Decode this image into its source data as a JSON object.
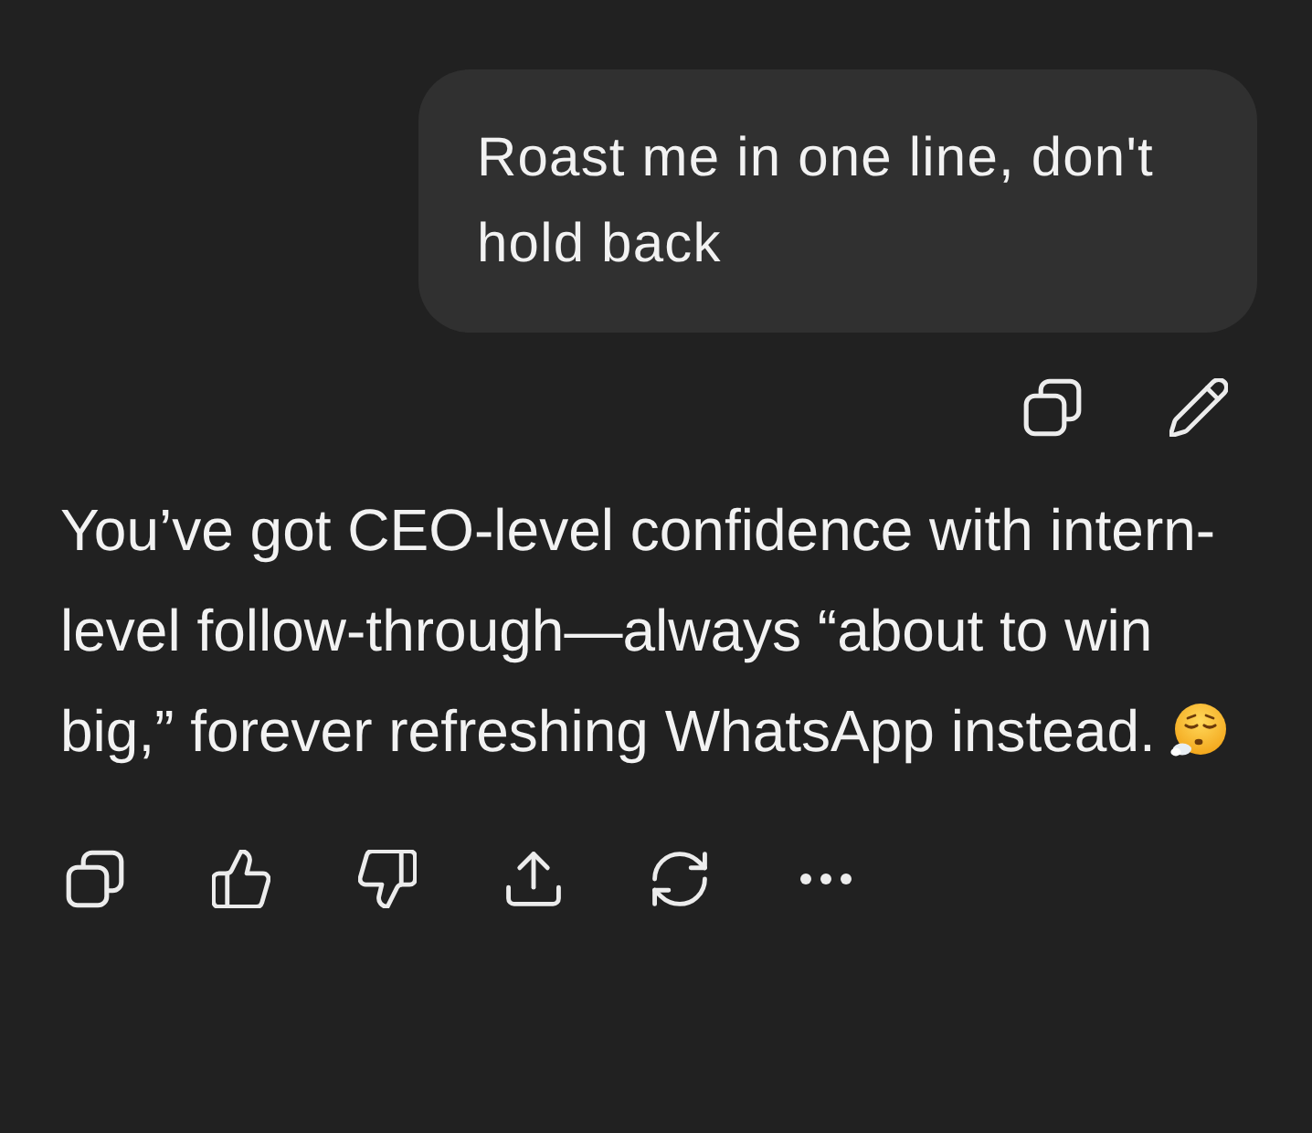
{
  "user_message": {
    "text": "Roast me in one line, don't hold back",
    "actions": [
      {
        "kind": "copy"
      },
      {
        "kind": "edit"
      }
    ]
  },
  "assistant_message": {
    "text": "You’ve got CEO-level confidence with intern-level follow-through—always “about to win big,” forever refreshing WhatsApp instead.",
    "actions": [
      {
        "kind": "copy"
      },
      {
        "kind": "like"
      },
      {
        "kind": "dislike"
      },
      {
        "kind": "share"
      },
      {
        "kind": "regenerate"
      },
      {
        "kind": "more"
      }
    ]
  }
}
